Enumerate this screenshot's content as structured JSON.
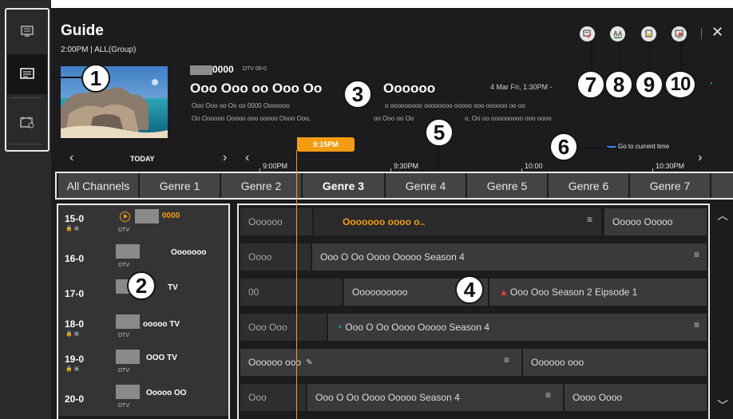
{
  "header": {
    "title": "Guide",
    "subtitle": "2:00PM | ALL(Group)"
  },
  "now_playing": {
    "channel_number": "0000",
    "dtv_label": "DTV 00-0",
    "program_title": "Ooo Ooo oo Ooo Oo",
    "program_title_tail": "Oooooo",
    "date_time": "4 Mar Fri, 1:30PM -",
    "desc_line1": "Ooo Ooo oo Oo oo 0000 Ooooooo",
    "desc_line1_tail": "o ooooooooo oooooooo ooooo ooo oooooo oo oo",
    "desc_line2": "Oo Oooooo Ooooo ooo ooooo Oooo Ooo,",
    "desc_line2_tail": "oo Ooo oo Oo",
    "desc_line2_end": "o, Oo oo ooooooooo ooo oooo"
  },
  "toolbar": {
    "close_label": "✕"
  },
  "date_nav": {
    "day_label": "TODAY",
    "go_current": "Go to current time",
    "now_time": "9:15PM",
    "ticks": [
      "9:00PM",
      "9:30PM",
      "10:00",
      "10:30PM"
    ]
  },
  "genre_tabs": [
    "All Channels",
    "Genre 1",
    "Genre 2",
    "Genre 3",
    "Genre 4",
    "Genre 5",
    "Genre 6",
    "Genre 7"
  ],
  "channels": [
    {
      "number": "15-0",
      "name": "0000",
      "dtv": "DTV"
    },
    {
      "number": "16-0",
      "name": "Ooooooo",
      "dtv": "DTV"
    },
    {
      "number": "17-0",
      "name": "TV",
      "dtv": ""
    },
    {
      "number": "18-0",
      "name": "ooooo TV",
      "dtv": "DTV"
    },
    {
      "number": "19-0",
      "name": "OOO TV",
      "dtv": "DTV"
    },
    {
      "number": "20-0",
      "name": "Ooooo OO",
      "dtv": "DTV"
    }
  ],
  "programs": {
    "r0": [
      "Oooooo",
      "Ooooooo oooo o..",
      "Ooooo Ooooo"
    ],
    "r1": [
      "Oooo",
      "Ooo O Oo Oooo Ooooo Season 4"
    ],
    "r2": [
      "00",
      "Oooooooooo",
      "Ooo Ooo Season 2 Eipsode 1"
    ],
    "r3": [
      "Ooo Ooo",
      "Ooo O Oo Oooo Ooooo Season 4"
    ],
    "r4": [
      "Oooooo ooo",
      "Oooooo ooo"
    ],
    "r5": [
      "Ooo",
      "Ooo O Oo Oooo Ooooo Season 4",
      "Oooo Oooo"
    ]
  },
  "callouts": [
    "1",
    "2",
    "3",
    "4",
    "5",
    "6",
    "7",
    "8",
    "9",
    "10"
  ],
  "colors": {
    "accent": "#f39c12",
    "reminder": "#1fb3b0",
    "record": "#e53935"
  }
}
